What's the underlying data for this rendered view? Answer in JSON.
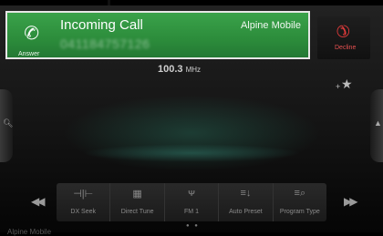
{
  "call": {
    "title": "Incoming Call",
    "caller_name": "Alpine Mobile",
    "caller_number": "041184757126",
    "answer_label": "Answer",
    "decline_label": "Decline"
  },
  "tuner": {
    "frequency": "100.3",
    "unit": "MHz"
  },
  "toolbar": {
    "items": [
      {
        "label": "DX Seek",
        "icon": "dx-seek-icon"
      },
      {
        "label": "Direct Tune",
        "icon": "keypad-icon"
      },
      {
        "label": "FM 1",
        "icon": "antenna-icon"
      },
      {
        "label": "Auto Preset",
        "icon": "auto-preset-icon"
      },
      {
        "label": "Program Type",
        "icon": "program-type-icon"
      }
    ]
  },
  "footer": {
    "device_name": "Alpine Mobile"
  },
  "colors": {
    "answer_green": "#2c8c3b",
    "decline_red": "#e03a3a"
  }
}
